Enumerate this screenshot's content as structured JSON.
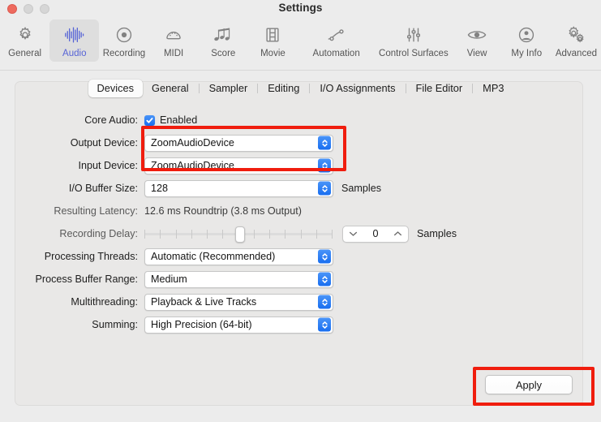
{
  "window": {
    "title": "Settings",
    "traffic_lights": [
      "close-button",
      "minimize-button",
      "zoom-button"
    ]
  },
  "toolbar": {
    "items": [
      {
        "label": "General",
        "icon": "gear-icon",
        "selected": false
      },
      {
        "label": "Audio",
        "icon": "waveform-icon",
        "selected": true
      },
      {
        "label": "Recording",
        "icon": "record-circle-icon",
        "selected": false
      },
      {
        "label": "MIDI",
        "icon": "midi-connector-icon",
        "selected": false
      },
      {
        "label": "Score",
        "icon": "music-notes-icon",
        "selected": false
      },
      {
        "label": "Movie",
        "icon": "film-strip-icon",
        "selected": false
      },
      {
        "label": "Automation",
        "icon": "automation-curve-icon",
        "selected": false
      },
      {
        "label": "Control Surfaces",
        "icon": "faders-icon",
        "selected": false
      },
      {
        "label": "View",
        "icon": "eye-icon",
        "selected": false
      },
      {
        "label": "My Info",
        "icon": "person-circle-icon",
        "selected": false
      },
      {
        "label": "Advanced",
        "icon": "double-gear-icon",
        "selected": false
      }
    ]
  },
  "tabs": [
    {
      "label": "Devices",
      "active": true
    },
    {
      "label": "General",
      "active": false
    },
    {
      "label": "Sampler",
      "active": false
    },
    {
      "label": "Editing",
      "active": false
    },
    {
      "label": "I/O Assignments",
      "active": false
    },
    {
      "label": "File Editor",
      "active": false
    },
    {
      "label": "MP3",
      "active": false
    }
  ],
  "form": {
    "core_audio": {
      "label": "Core Audio:",
      "checkbox_label": "Enabled",
      "checked": true
    },
    "output_device": {
      "label": "Output Device:",
      "value": "ZoomAudioDevice"
    },
    "input_device": {
      "label": "Input Device:",
      "value": "ZoomAudioDevice"
    },
    "io_buffer_size": {
      "label": "I/O Buffer Size:",
      "value": "128",
      "suffix": "Samples"
    },
    "resulting_latency": {
      "label": "Resulting Latency:",
      "value": "12.6 ms Roundtrip (3.8 ms Output)"
    },
    "recording_delay": {
      "label": "Recording Delay:",
      "value": "0",
      "suffix": "Samples",
      "slider_position_percent": 50
    },
    "processing_threads": {
      "label": "Processing Threads:",
      "value": "Automatic (Recommended)"
    },
    "process_buffer_range": {
      "label": "Process Buffer Range:",
      "value": "Medium"
    },
    "multithreading": {
      "label": "Multithreading:",
      "value": "Playback & Live Tracks"
    },
    "summing": {
      "label": "Summing:",
      "value": "High Precision (64-bit)"
    }
  },
  "apply_button": {
    "label": "Apply"
  },
  "annotations": {
    "highlight_color": "#f01d0e",
    "boxes": [
      {
        "name": "devices-highlight",
        "target": "output-and-input-device-rows"
      },
      {
        "name": "apply-highlight",
        "target": "apply-button"
      }
    ]
  },
  "colors": {
    "accent_blue": "#186ef0",
    "selected_tab_text": "#5663d6",
    "window_background": "#ececec",
    "panel_background": "#e9e8e7"
  }
}
